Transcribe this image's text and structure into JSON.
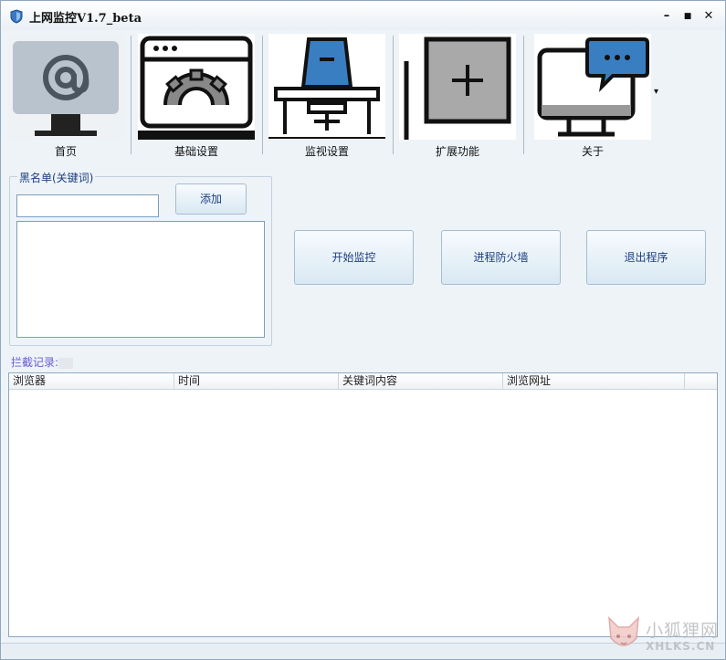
{
  "window": {
    "title": "上网监控V1.7_beta",
    "minimize_glyph": "–",
    "maximize_glyph": "■",
    "close_glyph": "✕"
  },
  "toolbar": {
    "items": [
      {
        "label": "首页",
        "icon": "at-sign-monitor-icon"
      },
      {
        "label": "基础设置",
        "icon": "browser-gear-icon"
      },
      {
        "label": "监视设置",
        "icon": "desk-chair-icon"
      },
      {
        "label": "扩展功能",
        "icon": "plus-box-icon"
      },
      {
        "label": "关于",
        "icon": "monitor-chat-icon"
      }
    ],
    "overflow_glyph": "▾"
  },
  "blacklist": {
    "legend": "黑名单(关键词)",
    "input_value": "",
    "add_label": "添加",
    "items": []
  },
  "actions": {
    "start_label": "开始监控",
    "firewall_label": "进程防火墙",
    "exit_label": "退出程序"
  },
  "log": {
    "label": "拦截记录:",
    "columns": [
      "浏览器",
      "时间",
      "关键词内容",
      "浏览网址"
    ],
    "rows": []
  },
  "watermark": {
    "cn": "小狐狸网",
    "en": "XHLKS.CN"
  },
  "colors": {
    "window_bg": "#edf3f7",
    "accent_blue": "#3a7ec2",
    "button_text": "#1e3e80",
    "log_label": "#6b5bd6"
  }
}
